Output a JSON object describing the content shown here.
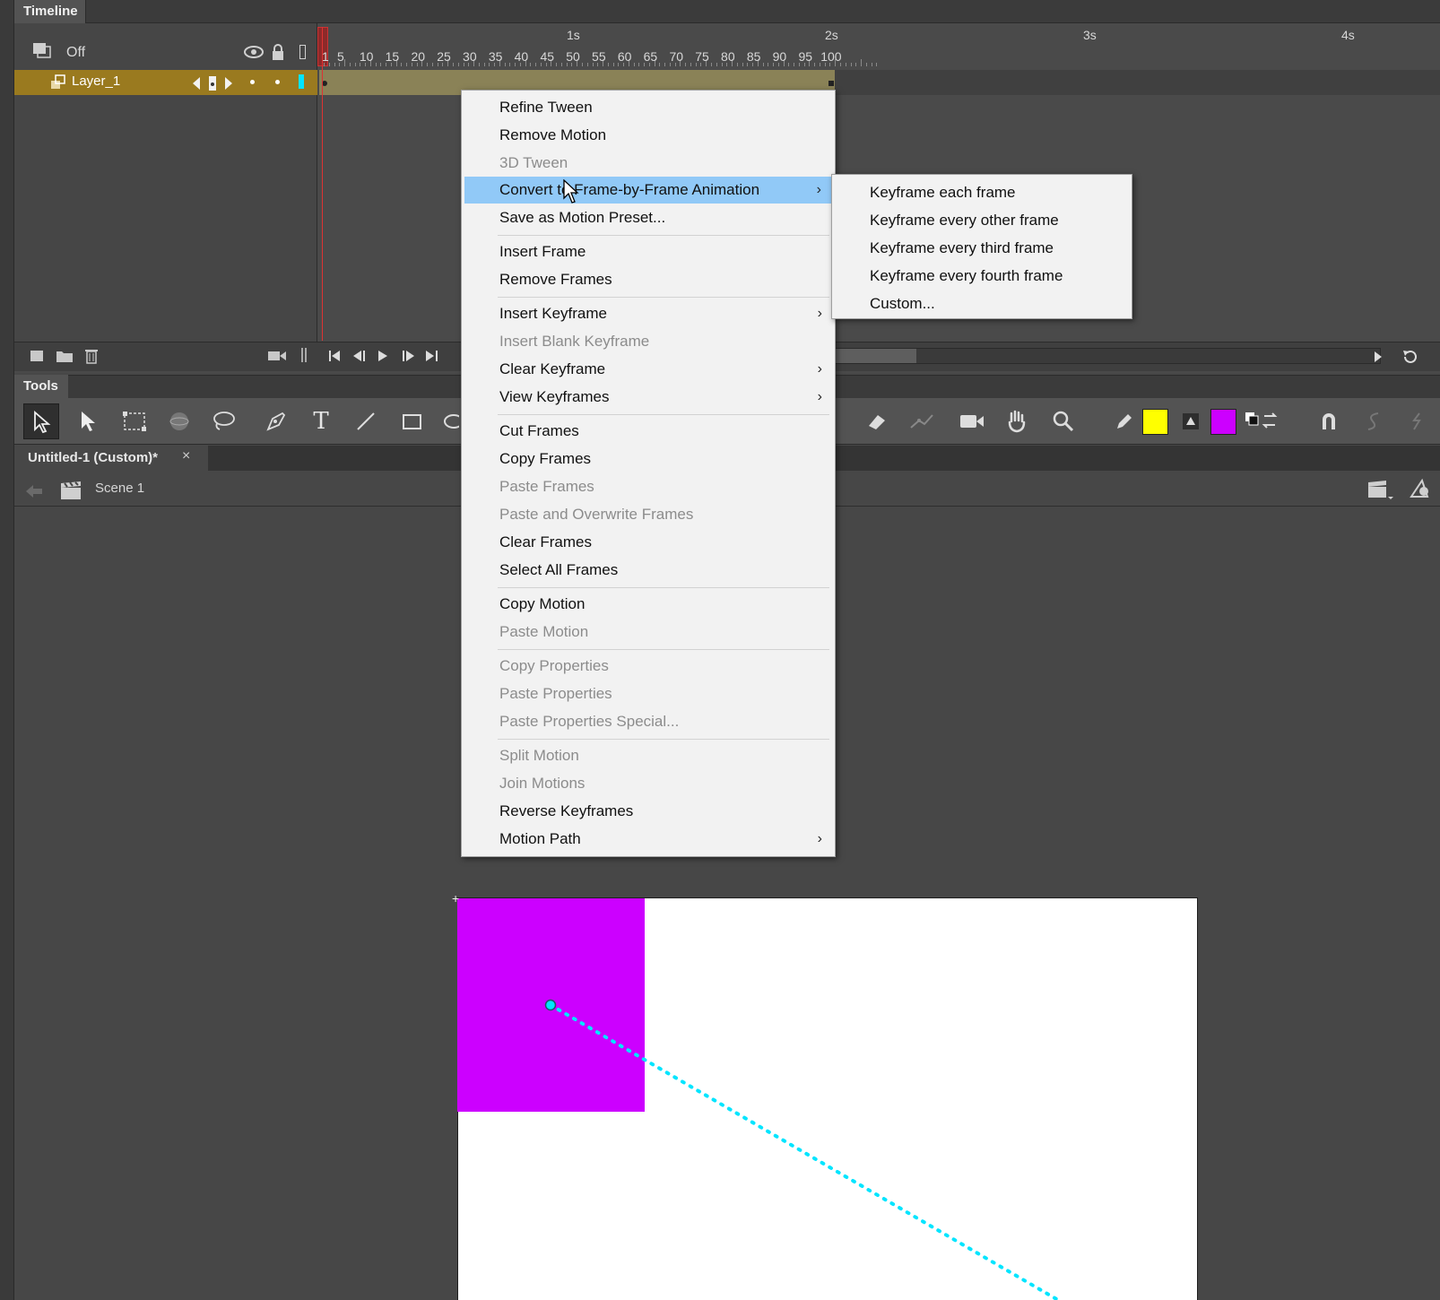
{
  "timeline": {
    "tab_label": "Timeline",
    "onion_label": "Off",
    "layer_name": "Layer_1",
    "seconds": [
      "1s",
      "2s",
      "3s",
      "4s"
    ],
    "frame_numbers": [
      "1",
      "5",
      "10",
      "15",
      "20",
      "25",
      "30",
      "35",
      "40",
      "45",
      "50",
      "55",
      "60",
      "65",
      "70",
      "75",
      "80",
      "85",
      "90",
      "95",
      "100"
    ]
  },
  "tools": {
    "tab_label": "Tools",
    "stroke_color": "#ffff00",
    "fill_color": "#cc00ff"
  },
  "document": {
    "tab_label": "Untitled-1 (Custom)*",
    "close_glyph": "×",
    "scene_label": "Scene 1"
  },
  "stage": {
    "background": "#ffffff",
    "shape_color": "#cc00ff",
    "motion_path_color": "#00e5ff"
  },
  "context_menu": {
    "items": [
      {
        "label": "Refine Tween",
        "disabled": false
      },
      {
        "label": "Remove Motion",
        "disabled": false
      },
      {
        "label": "3D Tween",
        "disabled": true
      },
      {
        "label": "Convert to Frame-by-Frame Animation",
        "disabled": false,
        "highlighted": true,
        "submenu": true
      },
      {
        "label": "Save as Motion Preset...",
        "disabled": false
      },
      {
        "label": "Insert Frame",
        "disabled": false
      },
      {
        "label": "Remove Frames",
        "disabled": false
      },
      {
        "label": "Insert Keyframe",
        "disabled": false,
        "submenu": true
      },
      {
        "label": "Insert Blank Keyframe",
        "disabled": true
      },
      {
        "label": "Clear Keyframe",
        "disabled": false,
        "submenu": true
      },
      {
        "label": "View Keyframes",
        "disabled": false,
        "submenu": true
      },
      {
        "label": "Cut Frames",
        "disabled": false
      },
      {
        "label": "Copy Frames",
        "disabled": false
      },
      {
        "label": "Paste Frames",
        "disabled": true
      },
      {
        "label": "Paste and Overwrite Frames",
        "disabled": true
      },
      {
        "label": "Clear Frames",
        "disabled": false
      },
      {
        "label": "Select All Frames",
        "disabled": false
      },
      {
        "label": "Copy Motion",
        "disabled": false
      },
      {
        "label": "Paste Motion",
        "disabled": true
      },
      {
        "label": "Copy Properties",
        "disabled": true
      },
      {
        "label": "Paste Properties",
        "disabled": true
      },
      {
        "label": "Paste Properties Special...",
        "disabled": true
      },
      {
        "label": "Split Motion",
        "disabled": true
      },
      {
        "label": "Join Motions",
        "disabled": true
      },
      {
        "label": "Reverse Keyframes",
        "disabled": false
      },
      {
        "label": "Motion Path",
        "disabled": false,
        "submenu": true
      }
    ],
    "submenu_arrow": "›"
  },
  "submenu": {
    "items": [
      {
        "label": "Keyframe each frame"
      },
      {
        "label": "Keyframe every other frame"
      },
      {
        "label": "Keyframe every third frame"
      },
      {
        "label": "Keyframe every fourth frame"
      },
      {
        "label": "Custom..."
      }
    ]
  }
}
